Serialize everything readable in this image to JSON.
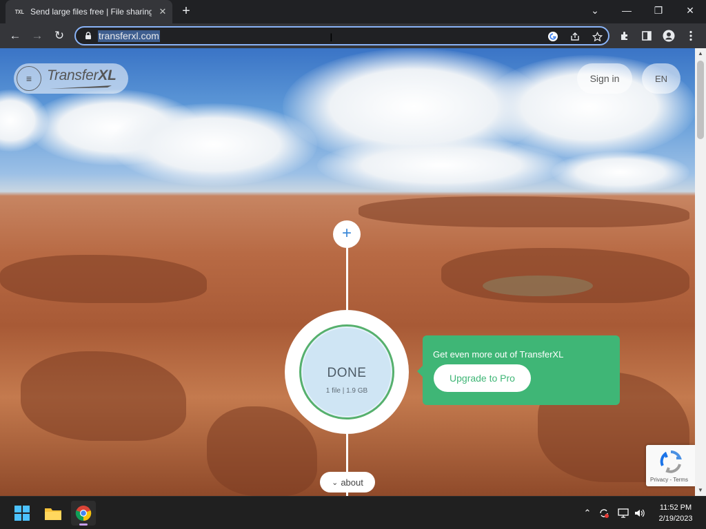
{
  "browser": {
    "tab": {
      "favicon_text": "TXL",
      "title": "Send large files free | File sharing",
      "close_glyph": "✕"
    },
    "new_tab_glyph": "+",
    "window_controls": [
      "⌄",
      "—",
      "❐",
      "✕"
    ],
    "toolbar": {
      "back_glyph": "←",
      "forward_glyph": "→",
      "reload_glyph": "↻",
      "url": "transferxl.com",
      "right_icons": [
        "extensions-icon",
        "side-panel-icon",
        "profile-icon",
        "more-icon"
      ]
    }
  },
  "site": {
    "logo_word1": "Transfer",
    "logo_word2": "XL",
    "menu_glyph": "≡",
    "sign_in_label": "Sign in",
    "language_label": "EN",
    "add_glyph": "+",
    "status": "DONE",
    "file_info": "1 file | 1.9 GB",
    "promo_text": "Get even more out of TransferXL",
    "upgrade_label": "Upgrade to Pro",
    "about_label": "about",
    "about_glyph": "⌄",
    "recaptcha_links": "Privacy - Terms"
  },
  "taskbar": {
    "time": "11:52 PM",
    "date": "2/19/2023"
  },
  "colors": {
    "accent_green": "#3fb676",
    "focus_blue": "#8ab4f8",
    "done_fill": "#cfe5f4"
  }
}
